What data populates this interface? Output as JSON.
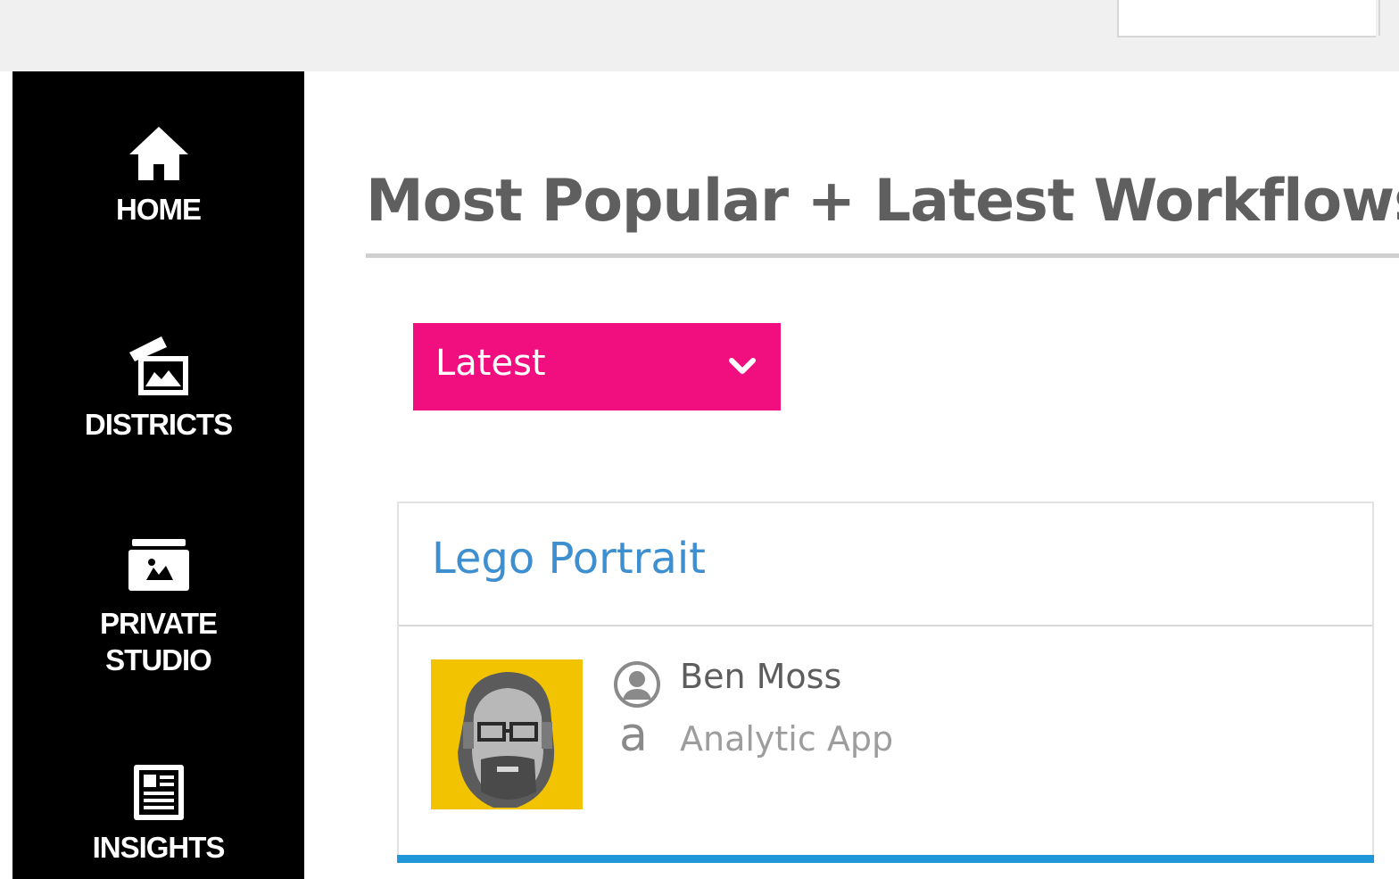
{
  "sidebar": {
    "items": [
      {
        "label": "HOME",
        "icon": "home-icon"
      },
      {
        "label": "DISTRICTS",
        "icon": "districts-icon"
      },
      {
        "label_line1": "PRIVATE",
        "label_line2": "STUDIO",
        "icon": "private-studio-icon"
      },
      {
        "label": "INSIGHTS",
        "icon": "insights-icon"
      }
    ]
  },
  "main": {
    "title": "Most Popular + Latest Workflows",
    "sort": {
      "selected": "Latest"
    },
    "cards": [
      {
        "title": "Lego Portrait",
        "author": "Ben Moss",
        "type_letter": "a",
        "type": "Analytic App"
      }
    ]
  },
  "colors": {
    "accent": "#f10f7f",
    "link": "#3e8fd0",
    "card_bar": "#1f97d8",
    "sidebar": "#000000"
  }
}
